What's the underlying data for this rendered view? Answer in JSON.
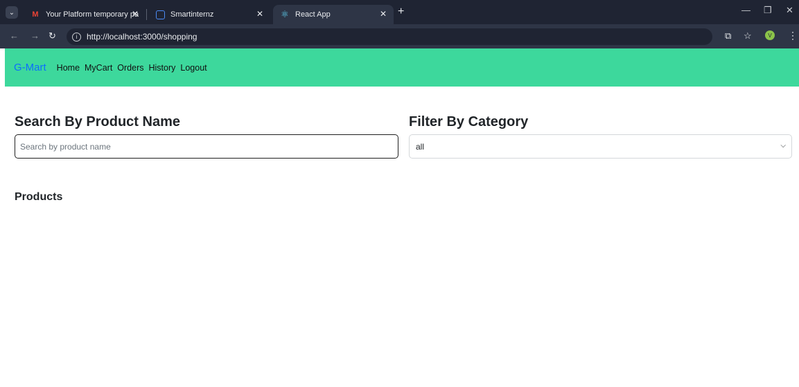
{
  "browser": {
    "tabs": [
      {
        "title": "Your Platform temporary passw",
        "icon": "gmail-icon",
        "active": false
      },
      {
        "title": "Smartinternz",
        "icon": "smartinternz-icon",
        "active": false
      },
      {
        "title": "React App",
        "icon": "react-icon",
        "active": true
      }
    ],
    "url": "http://localhost:3000/shopping",
    "avatar_initial": "V"
  },
  "navbar": {
    "brand": "G-Mart",
    "links": [
      "Home",
      "MyCart",
      "Orders",
      "History",
      "Logout"
    ],
    "background": "#3dd89c",
    "brand_color": "#0d6efd"
  },
  "search": {
    "heading": "Search By Product Name",
    "placeholder": "Search by product name",
    "value": ""
  },
  "filter": {
    "heading": "Filter By Category",
    "selected": "all"
  },
  "products": {
    "heading": "Products"
  }
}
